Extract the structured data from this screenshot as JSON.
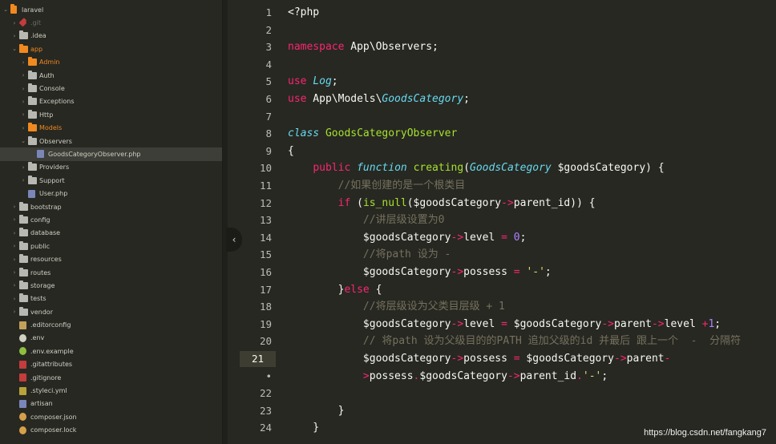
{
  "sidebar": {
    "items": [
      {
        "label": "laravel",
        "type": "project",
        "arrow": "⌄",
        "expanded": true
      },
      {
        "label": ".git",
        "type": "git",
        "arrow": "›",
        "dim": true
      },
      {
        "label": ".idea",
        "type": "folder",
        "arrow": "›"
      },
      {
        "label": "app",
        "type": "folder-orange",
        "arrow": "⌄",
        "highlight": true
      },
      {
        "label": "Admin",
        "type": "folder-orange",
        "arrow": "›",
        "highlight": true
      },
      {
        "label": "Auth",
        "type": "folder",
        "arrow": "›"
      },
      {
        "label": "Console",
        "type": "folder",
        "arrow": "›"
      },
      {
        "label": "Exceptions",
        "type": "folder",
        "arrow": "›"
      },
      {
        "label": "Http",
        "type": "folder",
        "arrow": "›"
      },
      {
        "label": "Models",
        "type": "folder-orange",
        "arrow": "›",
        "highlight": true
      },
      {
        "label": "Observers",
        "type": "folder",
        "arrow": "⌄"
      },
      {
        "label": "GoodsCategoryObserver.php",
        "type": "php",
        "arrow": "",
        "selected": true
      },
      {
        "label": "Providers",
        "type": "folder",
        "arrow": "›"
      },
      {
        "label": "Support",
        "type": "folder",
        "arrow": "›"
      },
      {
        "label": "User.php",
        "type": "php",
        "arrow": ""
      },
      {
        "label": "bootstrap",
        "type": "folder",
        "arrow": "›"
      },
      {
        "label": "config",
        "type": "folder",
        "arrow": "›"
      },
      {
        "label": "database",
        "type": "folder",
        "arrow": "›"
      },
      {
        "label": "public",
        "type": "folder",
        "arrow": "›"
      },
      {
        "label": "resources",
        "type": "folder",
        "arrow": "›"
      },
      {
        "label": "routes",
        "type": "folder",
        "arrow": "›"
      },
      {
        "label": "storage",
        "type": "folder",
        "arrow": "›"
      },
      {
        "label": "tests",
        "type": "folder",
        "arrow": "›"
      },
      {
        "label": "vendor",
        "type": "folder",
        "arrow": "›"
      },
      {
        "label": ".editorconfig",
        "type": "editorconfig",
        "arrow": ""
      },
      {
        "label": ".env",
        "type": "gear",
        "arrow": ""
      },
      {
        "label": ".env.example",
        "type": "gear-green",
        "arrow": ""
      },
      {
        "label": ".gitattributes",
        "type": "git-file",
        "arrow": ""
      },
      {
        "label": ".gitignore",
        "type": "git-file",
        "arrow": ""
      },
      {
        "label": ".styleci.yml",
        "type": "yml",
        "arrow": ""
      },
      {
        "label": "artisan",
        "type": "php",
        "arrow": ""
      },
      {
        "label": "composer.json",
        "type": "composer",
        "arrow": ""
      },
      {
        "label": "composer.lock",
        "type": "composer",
        "arrow": ""
      }
    ]
  },
  "editor": {
    "collapse_glyph": "‹",
    "lines": [
      {
        "n": "1",
        "tokens": [
          [
            "plain",
            "<?php"
          ]
        ]
      },
      {
        "n": "2",
        "tokens": []
      },
      {
        "n": "3",
        "tokens": [
          [
            "kw",
            "namespace"
          ],
          [
            "plain",
            " App\\Observers;"
          ]
        ]
      },
      {
        "n": "4",
        "tokens": []
      },
      {
        "n": "5",
        "tokens": [
          [
            "kw",
            "use"
          ],
          [
            "plain",
            " "
          ],
          [
            "cls",
            "Log"
          ],
          [
            "plain",
            ";"
          ]
        ]
      },
      {
        "n": "6",
        "tokens": [
          [
            "kw",
            "use"
          ],
          [
            "plain",
            " App\\Models\\"
          ],
          [
            "cls",
            "GoodsCategory"
          ],
          [
            "plain",
            ";"
          ]
        ]
      },
      {
        "n": "7",
        "tokens": []
      },
      {
        "n": "8",
        "tokens": [
          [
            "sto",
            "class"
          ],
          [
            "plain",
            " "
          ],
          [
            "fn",
            "GoodsCategoryObserver"
          ]
        ]
      },
      {
        "n": "9",
        "tokens": [
          [
            "plain",
            "{"
          ]
        ]
      },
      {
        "n": "10",
        "tokens": [
          [
            "plain",
            "    "
          ],
          [
            "kw",
            "public"
          ],
          [
            "plain",
            " "
          ],
          [
            "sto",
            "function"
          ],
          [
            "plain",
            " "
          ],
          [
            "fn",
            "creating"
          ],
          [
            "plain",
            "("
          ],
          [
            "cls",
            "GoodsCategory"
          ],
          [
            "plain",
            " $goodsCategory) {"
          ]
        ]
      },
      {
        "n": "11",
        "tokens": [
          [
            "plain",
            "        "
          ],
          [
            "cmt",
            "//如果创建的是一个根类目"
          ]
        ]
      },
      {
        "n": "12",
        "tokens": [
          [
            "plain",
            "        "
          ],
          [
            "kw",
            "if"
          ],
          [
            "plain",
            " ("
          ],
          [
            "fn",
            "is_null"
          ],
          [
            "plain",
            "($goodsCategory"
          ],
          [
            "op",
            "->"
          ],
          [
            "plain",
            "parent_id)) {"
          ]
        ]
      },
      {
        "n": "13",
        "tokens": [
          [
            "plain",
            "            "
          ],
          [
            "cmt",
            "//讲层级设置为0"
          ]
        ]
      },
      {
        "n": "14",
        "tokens": [
          [
            "plain",
            "            $goodsCategory"
          ],
          [
            "op",
            "->"
          ],
          [
            "plain",
            "level "
          ],
          [
            "op",
            "="
          ],
          [
            "plain",
            " "
          ],
          [
            "num",
            "0"
          ],
          [
            "plain",
            ";"
          ]
        ]
      },
      {
        "n": "15",
        "tokens": [
          [
            "plain",
            "            "
          ],
          [
            "cmt",
            "//将path 设为 -"
          ]
        ]
      },
      {
        "n": "16",
        "tokens": [
          [
            "plain",
            "            $goodsCategory"
          ],
          [
            "op",
            "->"
          ],
          [
            "plain",
            "possess "
          ],
          [
            "op",
            "="
          ],
          [
            "plain",
            " "
          ],
          [
            "str",
            "'-'"
          ],
          [
            "plain",
            ";"
          ]
        ]
      },
      {
        "n": "17",
        "tokens": [
          [
            "plain",
            "        }"
          ],
          [
            "kw",
            "else"
          ],
          [
            "plain",
            " {"
          ]
        ]
      },
      {
        "n": "18",
        "tokens": [
          [
            "plain",
            "            "
          ],
          [
            "cmt",
            "//将层级设为父类目层级 + 1"
          ]
        ]
      },
      {
        "n": "19",
        "tokens": [
          [
            "plain",
            "            $goodsCategory"
          ],
          [
            "op",
            "->"
          ],
          [
            "plain",
            "level "
          ],
          [
            "op",
            "="
          ],
          [
            "plain",
            " $goodsCategory"
          ],
          [
            "op",
            "->"
          ],
          [
            "plain",
            "parent"
          ],
          [
            "op",
            "->"
          ],
          [
            "plain",
            "level "
          ],
          [
            "op",
            "+"
          ],
          [
            "num",
            "1"
          ],
          [
            "plain",
            ";"
          ]
        ]
      },
      {
        "n": "20",
        "tokens": [
          [
            "plain",
            "            "
          ],
          [
            "cmt",
            "// 将path 设为父级目的的PATH 追加父级的id 并最后 跟上一个  -  分隔符"
          ]
        ]
      },
      {
        "n": "21",
        "tokens": [
          [
            "plain",
            "            $goodsCategory"
          ],
          [
            "op",
            "->"
          ],
          [
            "plain",
            "possess "
          ],
          [
            "op",
            "="
          ],
          [
            "plain",
            " $goodsCategory"
          ],
          [
            "op",
            "->"
          ],
          [
            "plain",
            "parent"
          ],
          [
            "op",
            "-"
          ]
        ],
        "active": true
      },
      {
        "n": "•",
        "tokens": [
          [
            "plain",
            "            "
          ],
          [
            "op",
            ">"
          ],
          [
            "plain",
            "possess"
          ],
          [
            "op",
            "."
          ],
          [
            "plain",
            "$goodsCategory"
          ],
          [
            "op",
            "->"
          ],
          [
            "plain",
            "parent_id"
          ],
          [
            "op",
            "."
          ],
          [
            "str",
            "'-'"
          ],
          [
            "plain",
            ";"
          ]
        ]
      },
      {
        "n": "22",
        "tokens": []
      },
      {
        "n": "23",
        "tokens": [
          [
            "plain",
            "        }"
          ]
        ]
      },
      {
        "n": "24",
        "tokens": [
          [
            "plain",
            "    }"
          ]
        ]
      }
    ]
  },
  "watermark": "https://blog.csdn.net/fangkang7",
  "colors": {
    "background": "#272822",
    "keyword": "#f92672",
    "function": "#a6e22e",
    "type": "#66d9ef",
    "string": "#e6db74",
    "comment": "#75715e",
    "number": "#ae81ff"
  }
}
